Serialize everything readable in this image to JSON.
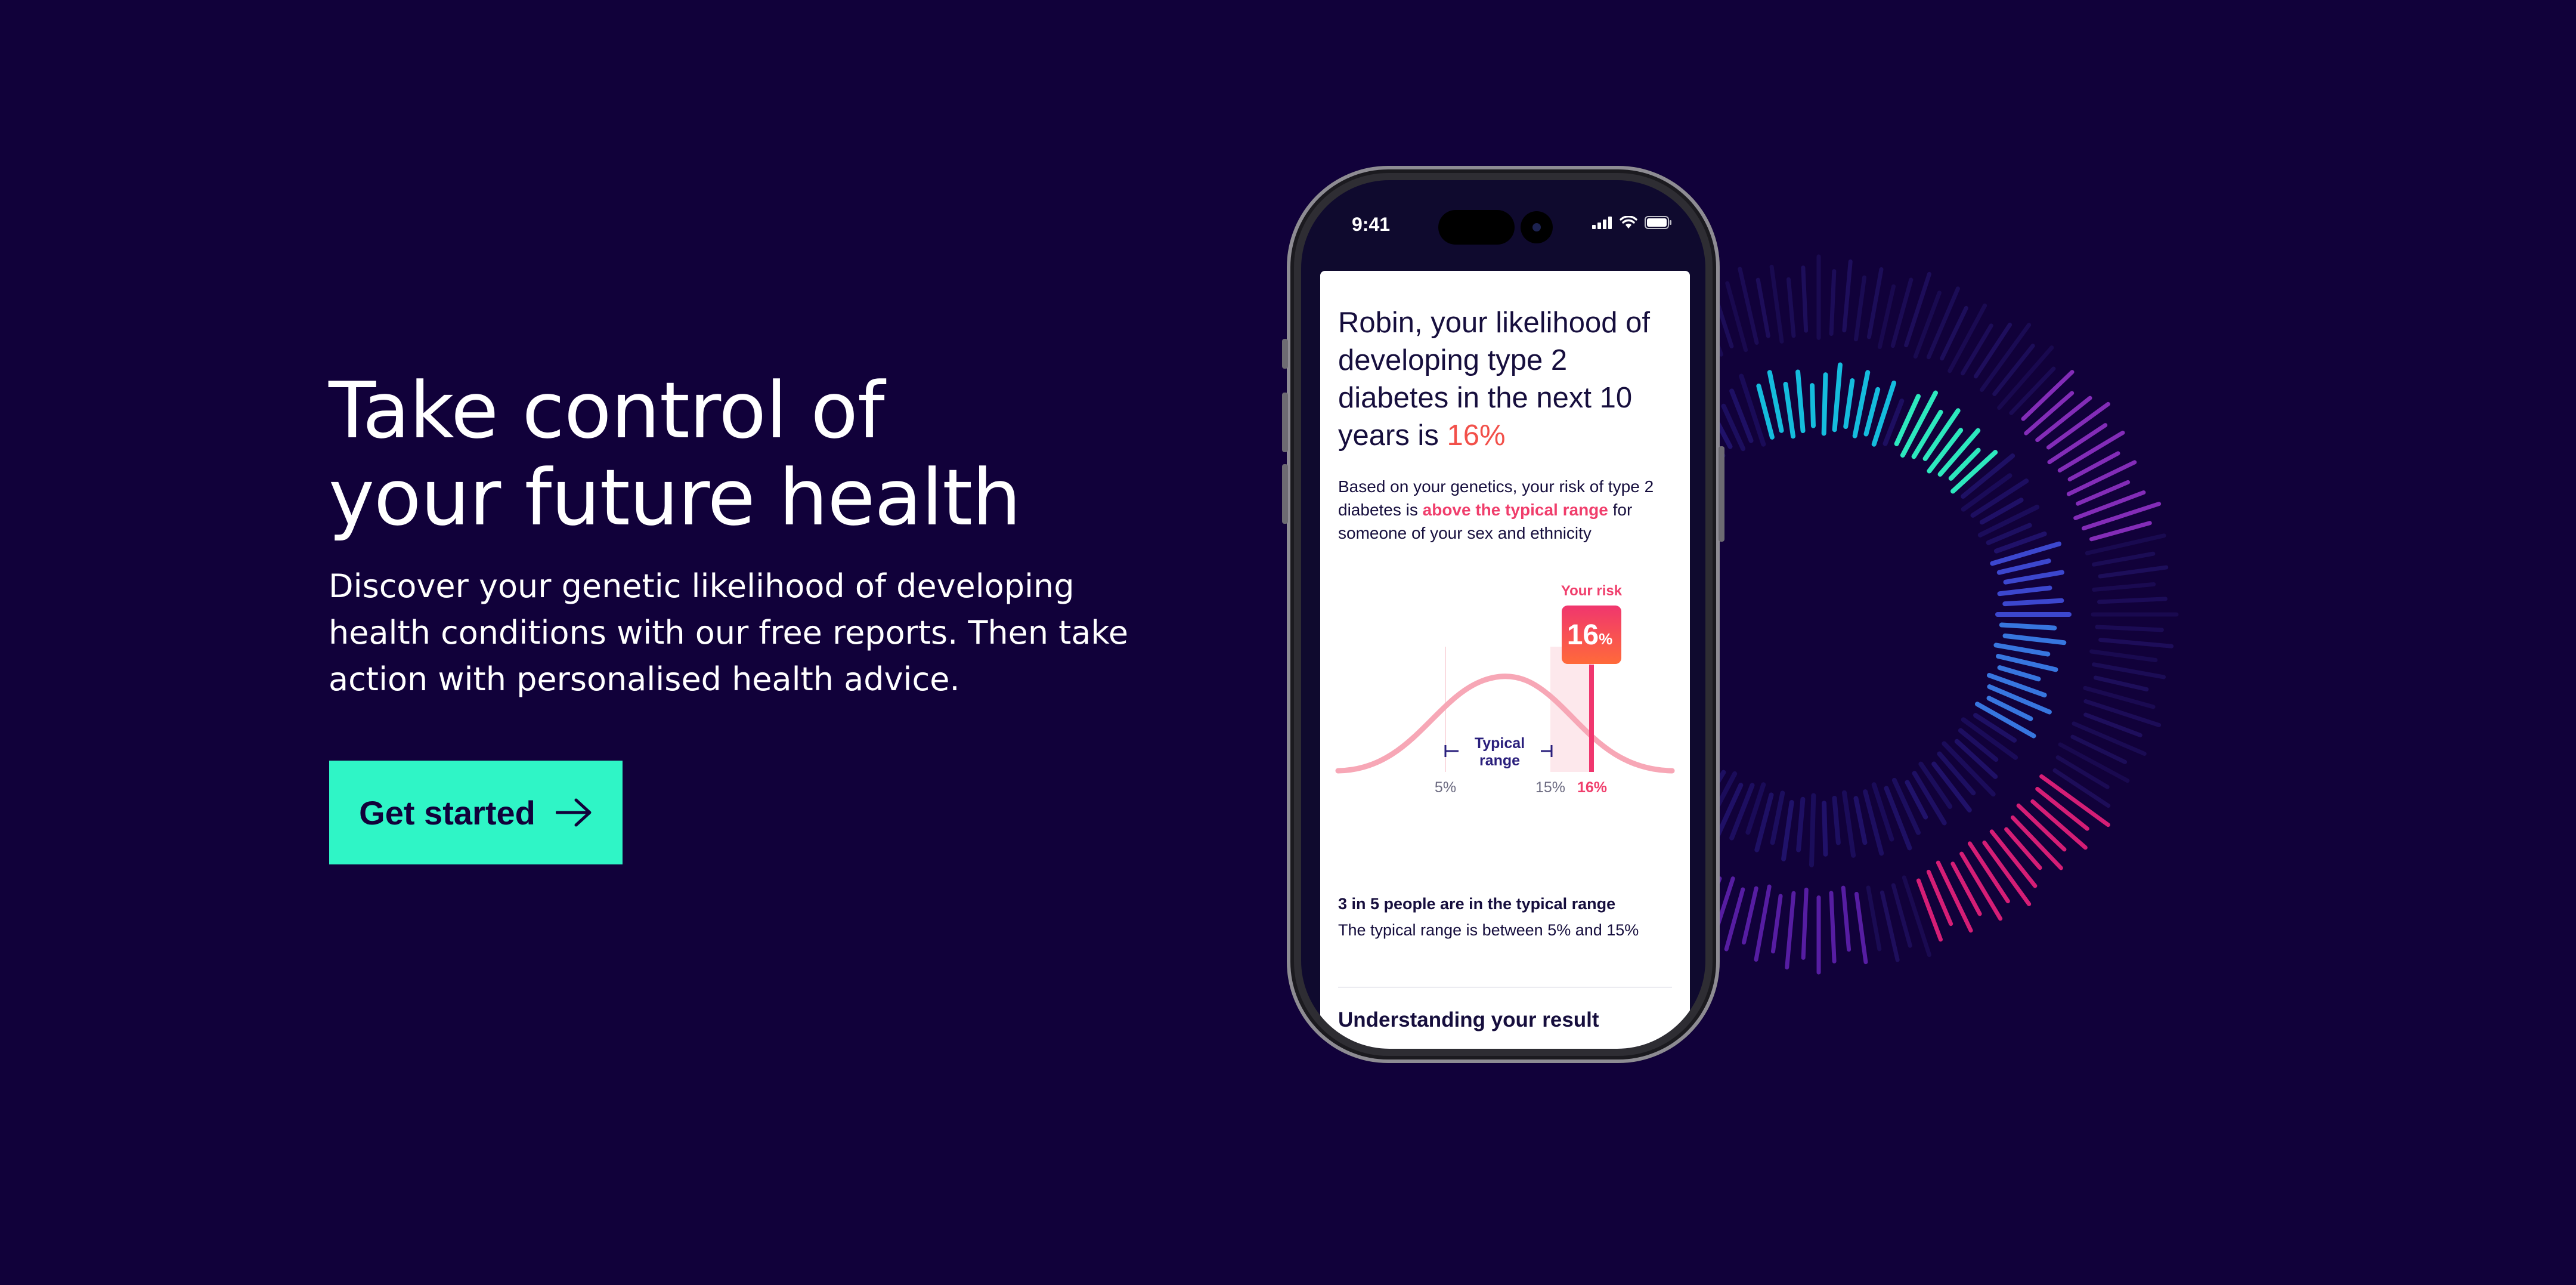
{
  "hero": {
    "headline_line1": "Take control of",
    "headline_line2": "your future health",
    "subtext_line1": "Discover your genetic likelihood of developing",
    "subtext_line2": "health conditions with our free reports. Then take",
    "subtext_line3": "action with personalised health advice.",
    "cta_label": "Get started"
  },
  "phone": {
    "status_time": "9:41"
  },
  "report": {
    "title_main": "Robin, your likelihood of developing type 2 diabetes in the next 10 years is ",
    "title_value": "16%",
    "body_before": "Based on your genetics, your risk of type 2 diabetes is ",
    "body_highlight": "above the typical range",
    "body_after": " for someone of your sex and ethnicity",
    "chart": {
      "your_risk_label": "Your risk",
      "risk_value": "16",
      "risk_unit": "%",
      "typical_line1": "Typical",
      "typical_line2": "range",
      "tick_low": "5%",
      "tick_high": "15%",
      "tick_user": "16%"
    },
    "stat_bold": "3 in 5 people are in the typical range",
    "stat_sub": "The typical range is between 5% and 15%",
    "section_heading": "Understanding your result"
  },
  "colors": {
    "background": "#11013a",
    "cta": "#2ff5c6",
    "accent_red": "#f2504a",
    "accent_pink": "#f03e6c"
  }
}
